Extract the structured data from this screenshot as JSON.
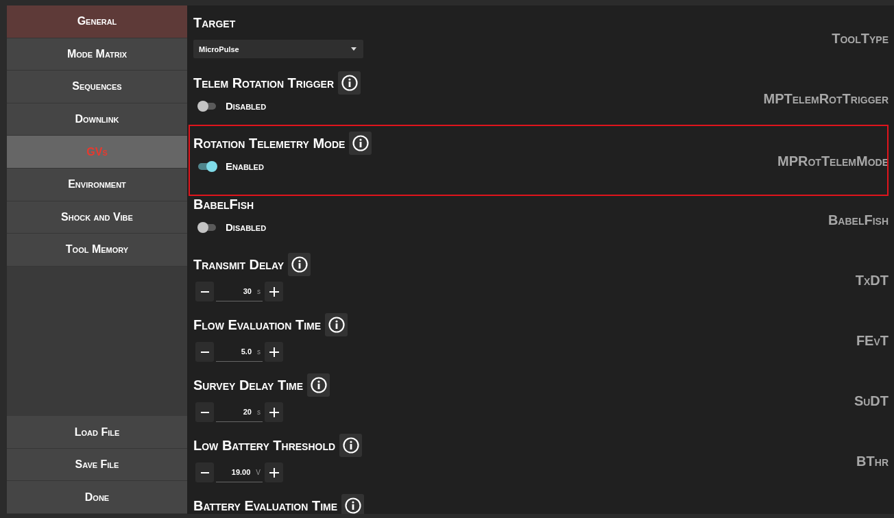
{
  "sidebar": {
    "nav_items": [
      {
        "label": "General",
        "active": true,
        "selected": false
      },
      {
        "label": "Mode Matrix",
        "active": false,
        "selected": false
      },
      {
        "label": "Sequences",
        "active": false,
        "selected": false
      },
      {
        "label": "Downlink",
        "active": false,
        "selected": false
      },
      {
        "label": "GVs",
        "active": false,
        "selected": true
      },
      {
        "label": "Environment",
        "active": false,
        "selected": false
      },
      {
        "label": "Shock and Vibe",
        "active": false,
        "selected": false
      },
      {
        "label": "Tool Memory",
        "active": false,
        "selected": false
      }
    ],
    "actions": [
      {
        "label": "Load File"
      },
      {
        "label": "Save File"
      },
      {
        "label": "Done"
      }
    ]
  },
  "settings": [
    {
      "kind": "dropdown",
      "title": "Target",
      "info": false,
      "highlighted": false,
      "value": "MicroPulse",
      "code": "ToolType"
    },
    {
      "kind": "toggle",
      "title": "Telem Rotation Trigger",
      "info": true,
      "highlighted": false,
      "on": false,
      "state_label": "Disabled",
      "code": "MPTelemRotTrigger"
    },
    {
      "kind": "toggle",
      "title": "Rotation Telemetry Mode",
      "info": true,
      "highlighted": true,
      "on": true,
      "state_label": "Enabled",
      "code": "MPRotTelemMode"
    },
    {
      "kind": "toggle",
      "title": "BabelFish",
      "info": false,
      "highlighted": false,
      "on": false,
      "state_label": "Disabled",
      "code": "BabelFish"
    },
    {
      "kind": "stepper",
      "title": "Transmit Delay",
      "info": true,
      "highlighted": false,
      "value": "30",
      "unit": "s",
      "code": "TxDT"
    },
    {
      "kind": "stepper",
      "title": "Flow Evaluation Time",
      "info": true,
      "highlighted": false,
      "value": "5.0",
      "unit": "s",
      "code": "FEvT"
    },
    {
      "kind": "stepper",
      "title": "Survey Delay Time",
      "info": true,
      "highlighted": false,
      "value": "20",
      "unit": "s",
      "code": "SuDT"
    },
    {
      "kind": "stepper",
      "title": "Low Battery Threshold",
      "info": true,
      "highlighted": false,
      "value": "19.00",
      "unit": "V",
      "code": "BThr"
    },
    {
      "kind": "heading",
      "title": "Battery Evaluation Time",
      "info": true,
      "highlighted": false
    }
  ]
}
